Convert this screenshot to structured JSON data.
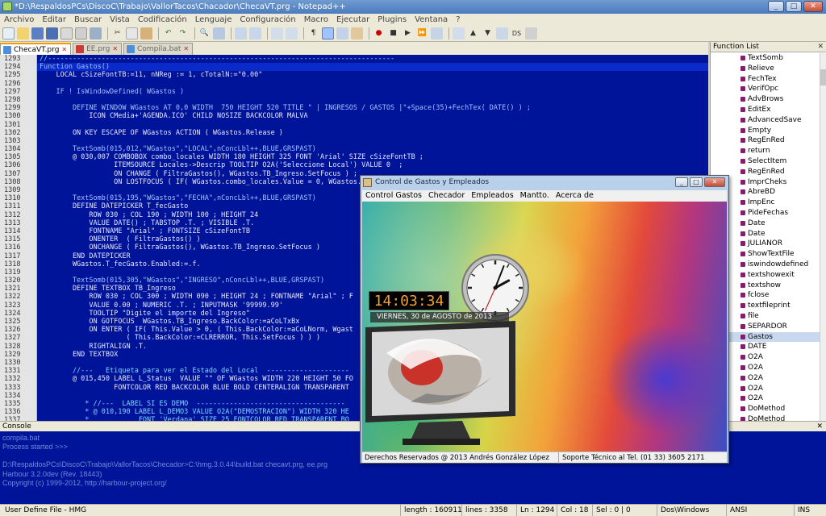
{
  "window": {
    "title": "*D:\\RespaldosPCs\\DiscoC\\Trabajo\\VallorTacos\\Chacador\\ChecaVT.prg - Notepad++",
    "controls": [
      "_",
      "□",
      "✕"
    ]
  },
  "menu": [
    "Archivo",
    "Editar",
    "Buscar",
    "Vista",
    "Codificación",
    "Lenguaje",
    "Configuración",
    "Macro",
    "Ejecutar",
    "Plugins",
    "Ventana",
    "?"
  ],
  "tabs": [
    {
      "label": "ChecaVT.prg",
      "active": true
    },
    {
      "label": "EE.prg",
      "active": false
    },
    {
      "label": "Compila.bat",
      "active": false
    }
  ],
  "editor": {
    "lines": [
      {
        "n": "1293",
        "t": "//------------------------------------------------------------------------------------",
        "c": "cm"
      },
      {
        "n": "1294",
        "t": "Function Gastos()",
        "c": "kw"
      },
      {
        "n": "1295",
        "t": "    LOCAL cSizeFontTB:=11, nNReg := 1, cTotalN:=\"0.00\"",
        "c": ""
      },
      {
        "n": "1296",
        "t": "",
        "c": ""
      },
      {
        "n": "1297",
        "t": "    IF ! IsWindowDefined( WGastos )",
        "c": "kw"
      },
      {
        "n": "1298",
        "t": "",
        "c": ""
      },
      {
        "n": "1299",
        "t": "        DEFINE WINDOW WGastos AT 0,0 WIDTH  750 HEIGHT 520 TITLE \" | INGRESOS / GASTOS |\"+Space(35)+FechTex( DATE() ) ;",
        "c": "kw"
      },
      {
        "n": "1300",
        "t": "            ICON CMedia+'AGENDA.ICO' CHILD NOSIZE BACKCOLOR MALVA",
        "c": ""
      },
      {
        "n": "1301",
        "t": "",
        "c": ""
      },
      {
        "n": "1302",
        "t": "        ON KEY ESCAPE OF WGastos ACTION ( WGastos.Release )",
        "c": ""
      },
      {
        "n": "1303",
        "t": "",
        "c": ""
      },
      {
        "n": "1304",
        "t": "        TextSomb(015,012,\"WGastos\",\"LOCAL\",nConcLbl++,BLUE,GRSPAST)",
        "c": "kw"
      },
      {
        "n": "1305",
        "t": "        @ 030,007 COMBOBOX combo_locales WIDTH 180 HEIGHT 325 FONT 'Arial' SIZE cSizeFontTB ;",
        "c": ""
      },
      {
        "n": "1306",
        "t": "                  ITEMSOURCE Locales->Descrip TOOLTIP O2A('Seleccione Local') VALUE 0  ;",
        "c": ""
      },
      {
        "n": "1307",
        "t": "                  ON CHANGE ( FiltraGastos(), WGastos.TB_Ingreso.SetFocus ) ;",
        "c": ""
      },
      {
        "n": "1308",
        "t": "                  ON LOSTFOCUS ( IF( WGastos.combo_locales.Value = 0, WGastos.",
        "c": ""
      },
      {
        "n": "1309",
        "t": "",
        "c": ""
      },
      {
        "n": "1310",
        "t": "        TextSomb(015,195,\"WGastos\",\"FECHA\",nConcLbl++,BLUE,GRSPAST)",
        "c": "kw"
      },
      {
        "n": "1311",
        "t": "        DEFINE DATEPICKER T_fecGasto",
        "c": ""
      },
      {
        "n": "1312",
        "t": "            ROW 030 ; COL 190 ; WIDTH 100 ; HEIGHT 24",
        "c": ""
      },
      {
        "n": "1313",
        "t": "            VALUE DATE() ; TABSTOP .T. ; VISIBLE .T.",
        "c": ""
      },
      {
        "n": "1314",
        "t": "            FONTNAME \"Arial\" ; FONTSIZE cSizeFontTB",
        "c": ""
      },
      {
        "n": "1315",
        "t": "            ONENTER  ( FiltraGastos() )",
        "c": ""
      },
      {
        "n": "1316",
        "t": "            ONCHANGE ( FiltraGastos(), WGastos.TB_Ingreso.SetFocus )",
        "c": ""
      },
      {
        "n": "1317",
        "t": "        END DATEPICKER",
        "c": ""
      },
      {
        "n": "1318",
        "t": "        WGastos.T_fecGasto.Enabled:=.f.",
        "c": ""
      },
      {
        "n": "1319",
        "t": "",
        "c": ""
      },
      {
        "n": "1320",
        "t": "        TextSomb(015,305,\"WGastos\",\"INGRESO\",nConcLbl++,BLUE,GRSPAST)",
        "c": "kw"
      },
      {
        "n": "1321",
        "t": "        DEFINE TEXTBOX TB_Ingreso",
        "c": ""
      },
      {
        "n": "1322",
        "t": "            ROW 030 ; COL 300 ; WIDTH 090 ; HEIGHT 24 ; FONTNAME \"Arial\" ; F",
        "c": ""
      },
      {
        "n": "1323",
        "t": "            VALUE 0.00 ; NUMERIC .T. ; INPUTMASK '99999.99'",
        "c": ""
      },
      {
        "n": "1324",
        "t": "            TOOLTIP \"Digite el importe del Ingreso\"",
        "c": ""
      },
      {
        "n": "1325",
        "t": "            ON GOTFOCUS  WGastos.TB_Ingreso.BackColor:=aCoLTxBx",
        "c": ""
      },
      {
        "n": "1326",
        "t": "            ON ENTER ( IF( This.Value > 0, ( This.BackColor:=aCoLNorm, Wgast",
        "c": ""
      },
      {
        "n": "1327",
        "t": "                     ( This.BackColor:=CLRERROR, This.SetFocus ) ) )",
        "c": ""
      },
      {
        "n": "1328",
        "t": "            RIGHTALIGN .T.",
        "c": ""
      },
      {
        "n": "1329",
        "t": "        END TEXTBOX",
        "c": ""
      },
      {
        "n": "1330",
        "t": "",
        "c": ""
      },
      {
        "n": "1331",
        "t": "        //---   Etiqueta para ver el Estado del Local  --------------------",
        "c": "cm"
      },
      {
        "n": "1332",
        "t": "        @ 015,450 LABEL L_Status  VALUE \"\" OF WGastos WIDTH 220 HEIGHT 50 FO",
        "c": ""
      },
      {
        "n": "1333",
        "t": "                  FONTCOLOR RED BACKCOLOR BLUE BOLD CENTERALIGN TRANSPARENT",
        "c": ""
      },
      {
        "n": "1334",
        "t": "",
        "c": ""
      },
      {
        "n": "1335",
        "t": "           * //---  LABEL SI ES DEMO  ------------------------------------",
        "c": "cm"
      },
      {
        "n": "1336",
        "t": "           * @ 010,190 LABEL L_DEMO3 VALUE O2A(\"DEMOSTRACION\") WIDTH 320 HE",
        "c": "cm"
      },
      {
        "n": "1337",
        "t": "           *            FONT 'Verdana' SIZE 25 FONTCOLOR RED TRANSPARENT BO",
        "c": "cm"
      },
      {
        "n": "1338",
        "t": "",
        "c": ""
      }
    ]
  },
  "function_list": {
    "title": "Function List",
    "items": [
      "TextSomb",
      "Relieve",
      "FechTex",
      "VerifOpc",
      "AdvBrows",
      "EditEx",
      "AdvancedSave",
      "Empty",
      "RegEnRed",
      "return",
      "SelectItem",
      "RegEnRed",
      "ImprCheks",
      "AbreBD",
      "ImpEnc",
      "PideFechas",
      "Date",
      "Date",
      "JULIANOR",
      "ShowTextFile",
      "iswindowdefined",
      "textshowexit",
      "textshow",
      "fclose",
      "textfileprint",
      "file",
      "SEPARDOR",
      "Gastos",
      "DATE",
      "O2A",
      "O2A",
      "O2A",
      "O2A",
      "O2A",
      "DoMethod",
      "DoMethod"
    ]
  },
  "console": {
    "title": "Console",
    "lines": [
      "compila.bat",
      "Process started >>>",
      "",
      "D:\\RespaldosPCs\\DiscoC\\Trabajo\\VallorTacos\\Checador>C:\\hmg.3.0.44\\build.bat checavt.prg, ee.prg",
      "Harbour 3.2.0dev (Rev. 18443)",
      "Copyright (c) 1999-2012, http://harbour-project.org/"
    ]
  },
  "statusbar": {
    "filetype": "User Define File - HMG",
    "length": "length : 160911",
    "lines": "lines : 3358",
    "ln": "Ln : 1294",
    "col": "Col : 18",
    "sel": "Sel : 0 | 0",
    "eol": "Dos\\Windows",
    "encoding": "ANSI",
    "mode": "INS"
  },
  "app_window": {
    "title": "Control de Gastos y Empleados",
    "menu": [
      "Control Gastos",
      "Checador",
      "Empleados",
      "Mantto.",
      "Acerca de"
    ],
    "time": "14:03:34",
    "date": "VIERNES, 30 de AGOSTO de 2013",
    "status_left": "Derechos Reservados @ 2013 Andrés González López",
    "status_right": "Soporte Técnico al Tel. (01 33) 3605 2171",
    "clock": {
      "hour": 2,
      "minute": 3,
      "second": 34
    }
  }
}
